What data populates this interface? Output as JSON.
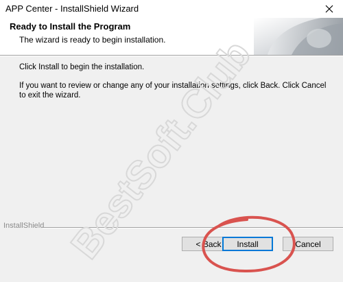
{
  "window": {
    "title": "APP Center - InstallShield Wizard",
    "close_icon": "close-icon"
  },
  "header": {
    "title": "Ready to Install the Program",
    "subtitle": "The wizard is ready to begin installation."
  },
  "body": {
    "line1": "Click Install to begin the installation.",
    "line2": "If you want to review or change any of your installation settings, click Back. Click Cancel to exit the wizard."
  },
  "footer": {
    "brand": "InstallShield"
  },
  "buttons": {
    "back": "< Back",
    "install": "Install",
    "cancel": "Cancel"
  },
  "watermark": {
    "text": "BestSoft.Club"
  },
  "colors": {
    "accent": "#0078d7",
    "highlight_circle": "#d9534f"
  }
}
